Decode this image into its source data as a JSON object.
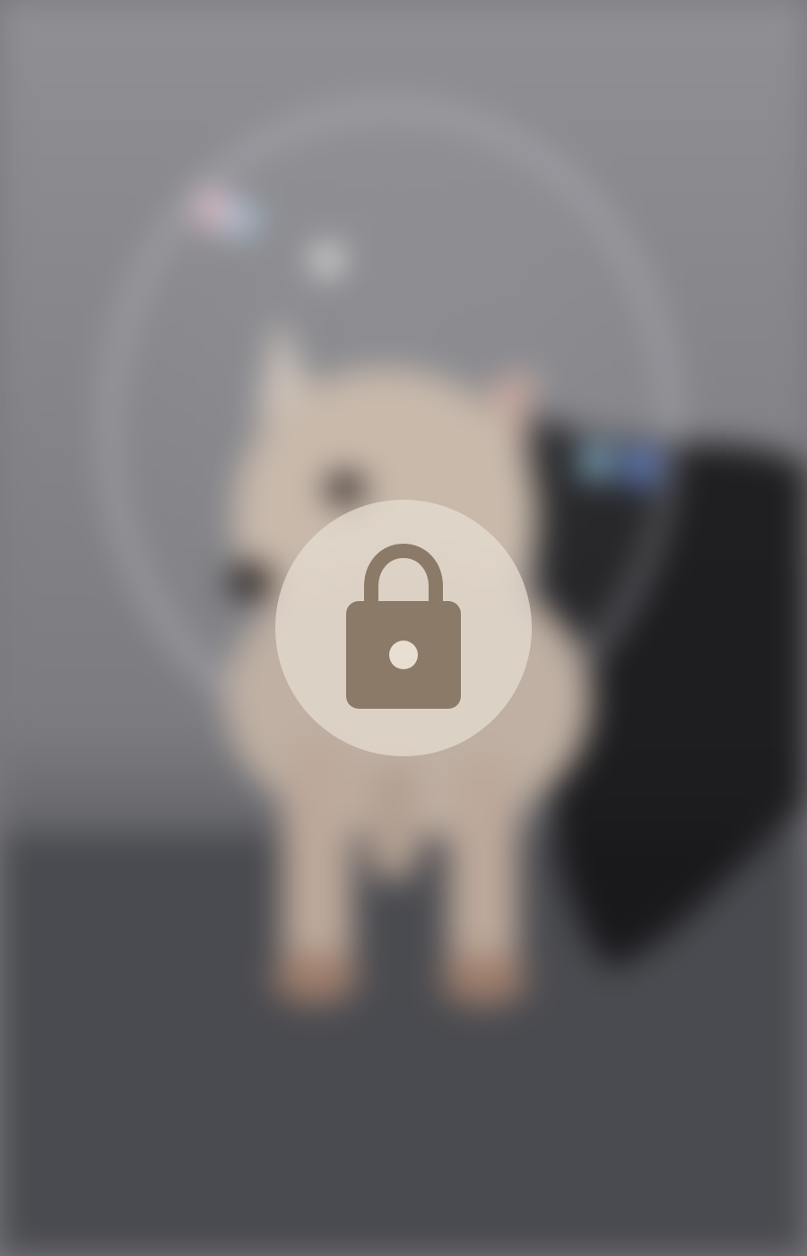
{
  "locked_media": {
    "icon": "lock-icon",
    "state": "locked",
    "blurred_subject": "dog-in-bubble-photo",
    "colors": {
      "background_top": "#8f8f94",
      "background_bottom": "#5b5c61",
      "floor": "#3f4045",
      "badge_fill": "#e8ded2",
      "lock_fill": "#8c7a69"
    }
  }
}
